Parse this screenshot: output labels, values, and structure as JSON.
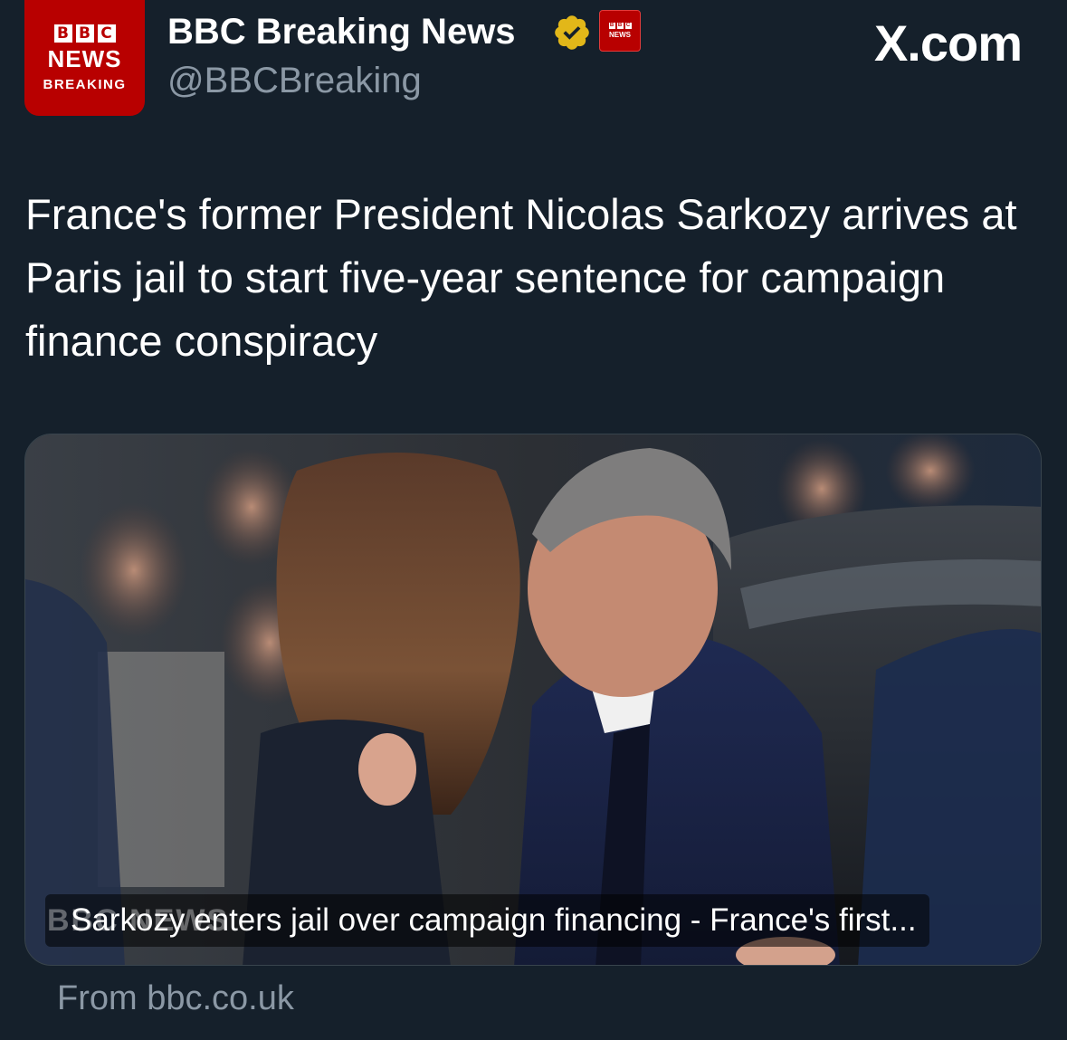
{
  "account": {
    "avatar": {
      "letters": [
        "B",
        "B",
        "C"
      ],
      "news": "NEWS",
      "breaking": "BREAKING"
    },
    "display_name": "BBC Breaking News",
    "handle": "@BBCBreaking",
    "verified_icon": "gold-verified-badge-icon",
    "affiliation_badge": {
      "letters": [
        "B",
        "B",
        "C"
      ],
      "news": "NEWS"
    }
  },
  "watermark": "X.com",
  "tweet": {
    "text": "France's former President Nicolas Sarkozy arrives at Paris jail to start five-year sentence for campaign finance conspiracy"
  },
  "link_card": {
    "image_description_icon": "photo-image",
    "overlay_logo": "BBC NEWS",
    "title": "Sarkozy enters jail over campaign financing - France's first...",
    "source": "From bbc.co.uk"
  },
  "colors": {
    "background": "#15202b",
    "bbc_red": "#b80000",
    "secondary_text": "#8b98a5",
    "verified_gold": "#e2b719"
  }
}
